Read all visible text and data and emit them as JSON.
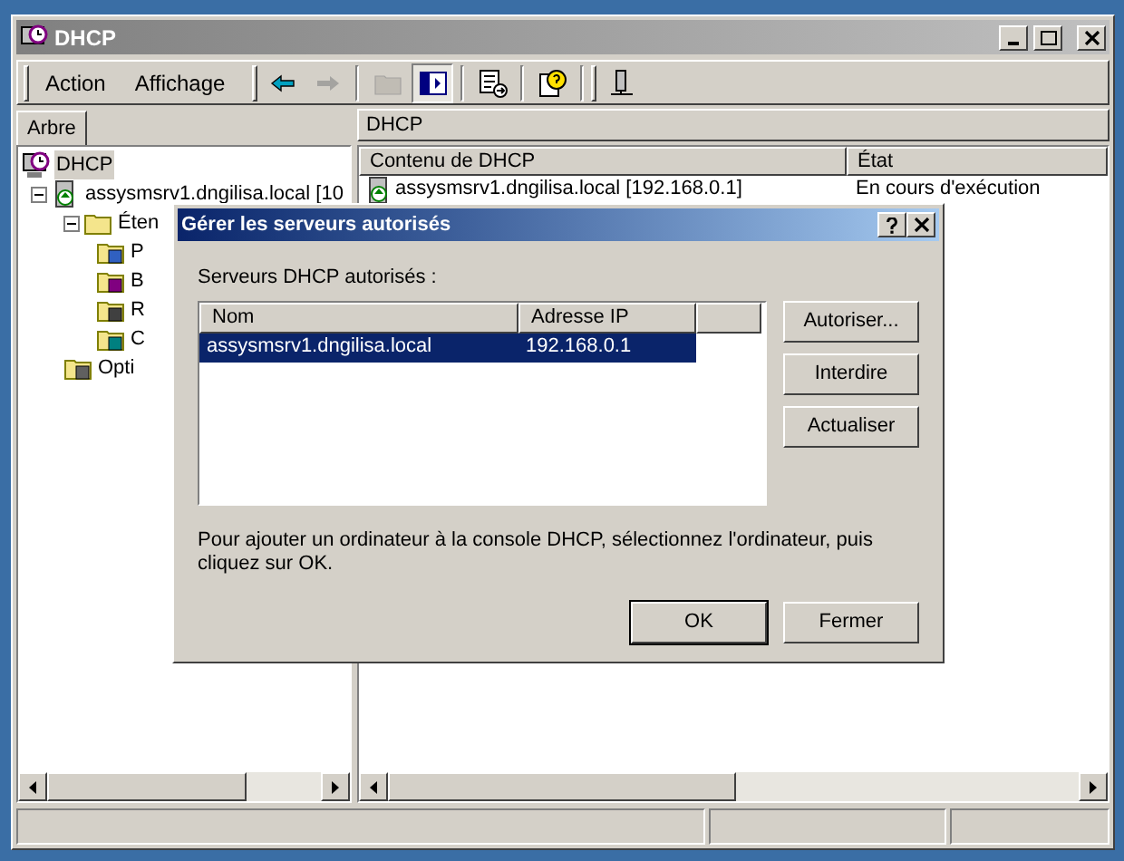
{
  "window": {
    "title": "DHCP"
  },
  "menu": [
    {
      "label": "Action"
    },
    {
      "label": "Affichage"
    }
  ],
  "toolbar": [
    {
      "kind": "back",
      "disabled": false,
      "pressed": false
    },
    {
      "kind": "forward",
      "disabled": true,
      "pressed": false
    },
    {
      "kind": "up",
      "disabled": true,
      "pressed": false
    },
    {
      "kind": "tree",
      "disabled": false,
      "pressed": true
    },
    {
      "kind": "export",
      "disabled": false,
      "pressed": false
    },
    {
      "kind": "help",
      "disabled": false,
      "pressed": false
    },
    {
      "kind": "server",
      "disabled": false,
      "pressed": false
    }
  ],
  "tree_tab": {
    "label": "Arbre"
  },
  "tree": [
    {
      "label": "DHCP",
      "kind": "dhcp",
      "selected": true,
      "children": [
        {
          "label": "assysmsrv1.dngilisa.local [10",
          "kind": "server",
          "selected": false,
          "expanded": true,
          "children": [
            {
              "label": "Éten",
              "kind": "folder",
              "selected": false,
              "expanded": true,
              "children": [
                {
                  "label": "P",
                  "kind": "pool",
                  "selected": false
                },
                {
                  "label": "B",
                  "kind": "lease",
                  "selected": false
                },
                {
                  "label": "R",
                  "kind": "reservation",
                  "selected": false
                },
                {
                  "label": "C",
                  "kind": "options",
                  "selected": false
                }
              ]
            },
            {
              "label": "Opti",
              "kind": "serveroptions",
              "selected": false
            }
          ]
        }
      ]
    }
  ],
  "right_pane": {
    "title": "DHCP",
    "columns": [
      "Contenu de DHCP",
      "État"
    ],
    "rows": [
      [
        "assysmsrv1.dngilisa.local [192.168.0.1]",
        "En cours d'exécution"
      ]
    ]
  },
  "dialog": {
    "title": "Gérer les serveurs autorisés",
    "list_label": "Serveurs DHCP autorisés :",
    "columns": [
      "Nom",
      "Adresse IP"
    ],
    "rows": [
      {
        "cells": [
          "assysmsrv1.dngilisa.local",
          "192.168.0.1"
        ],
        "selected": true
      }
    ],
    "side_buttons": [
      "Autoriser...",
      "Interdire",
      "Actualiser"
    ],
    "note": "Pour ajouter un ordinateur à la console DHCP, sélectionnez l'ordinateur, puis cliquez sur OK.",
    "buttons": [
      {
        "label": "OK",
        "default": true
      },
      {
        "label": "Fermer",
        "default": false
      }
    ]
  }
}
